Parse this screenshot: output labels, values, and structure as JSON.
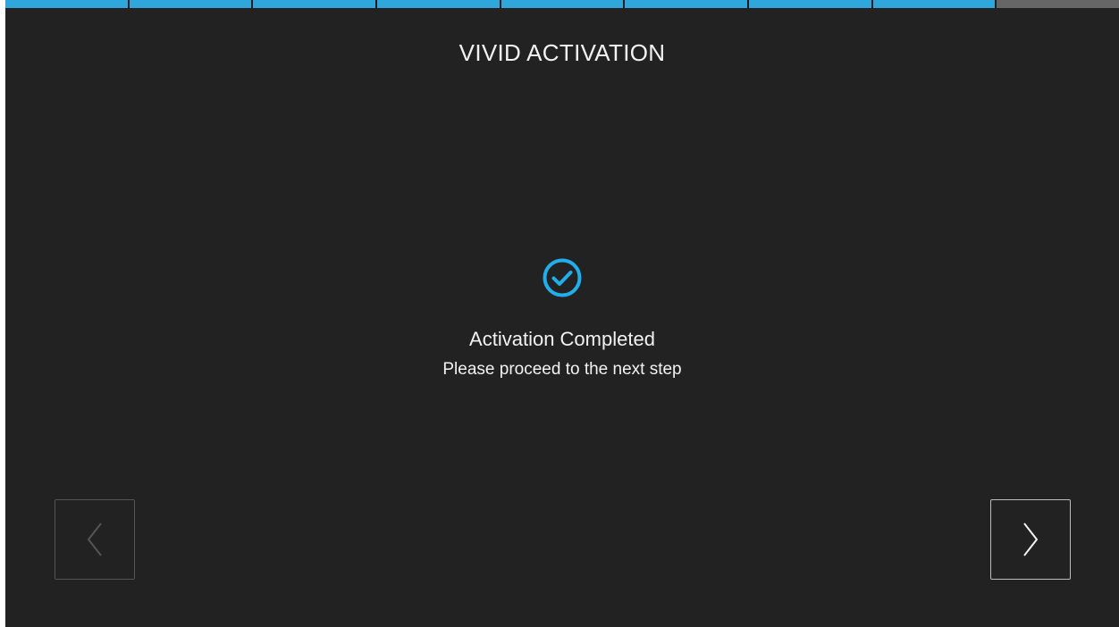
{
  "header": {
    "title": "VIVID ACTIVATION"
  },
  "progress": {
    "total_steps": 9,
    "completed_steps": 8,
    "completed_color": "#2fa6dc",
    "pending_color": "#666666"
  },
  "status": {
    "icon": "check-circle-icon",
    "icon_color": "#21aeea",
    "title": "Activation Completed",
    "subtitle": "Please proceed to the next step"
  },
  "navigation": {
    "prev": {
      "icon": "chevron-left-icon",
      "enabled": false
    },
    "next": {
      "icon": "chevron-right-icon",
      "enabled": true
    }
  }
}
